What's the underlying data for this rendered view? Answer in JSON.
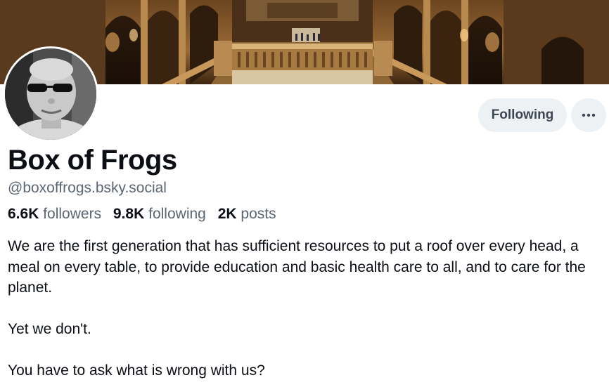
{
  "profile": {
    "display_name": "Box of Frogs",
    "handle": "@boxoffrogs.bsky.social",
    "stats": {
      "followers_count": "6.6K",
      "followers_label": "followers",
      "following_count": "9.8K",
      "following_label": "following",
      "posts_count": "2K",
      "posts_label": "posts"
    },
    "bio": "We are the first generation that has sufficient resources to put a roof over every head, a meal on every table, to provide education and basic health care to all, and to care for the planet.\n\nYet we don't.\n\nYou have to ask what is wrong with us?"
  },
  "actions": {
    "following_label": "Following",
    "more_icon": "more-horizontal-icon"
  },
  "colors": {
    "button_bg": "#eef1f4",
    "muted_text": "#5b6672",
    "primary_text": "#0b0f14"
  }
}
